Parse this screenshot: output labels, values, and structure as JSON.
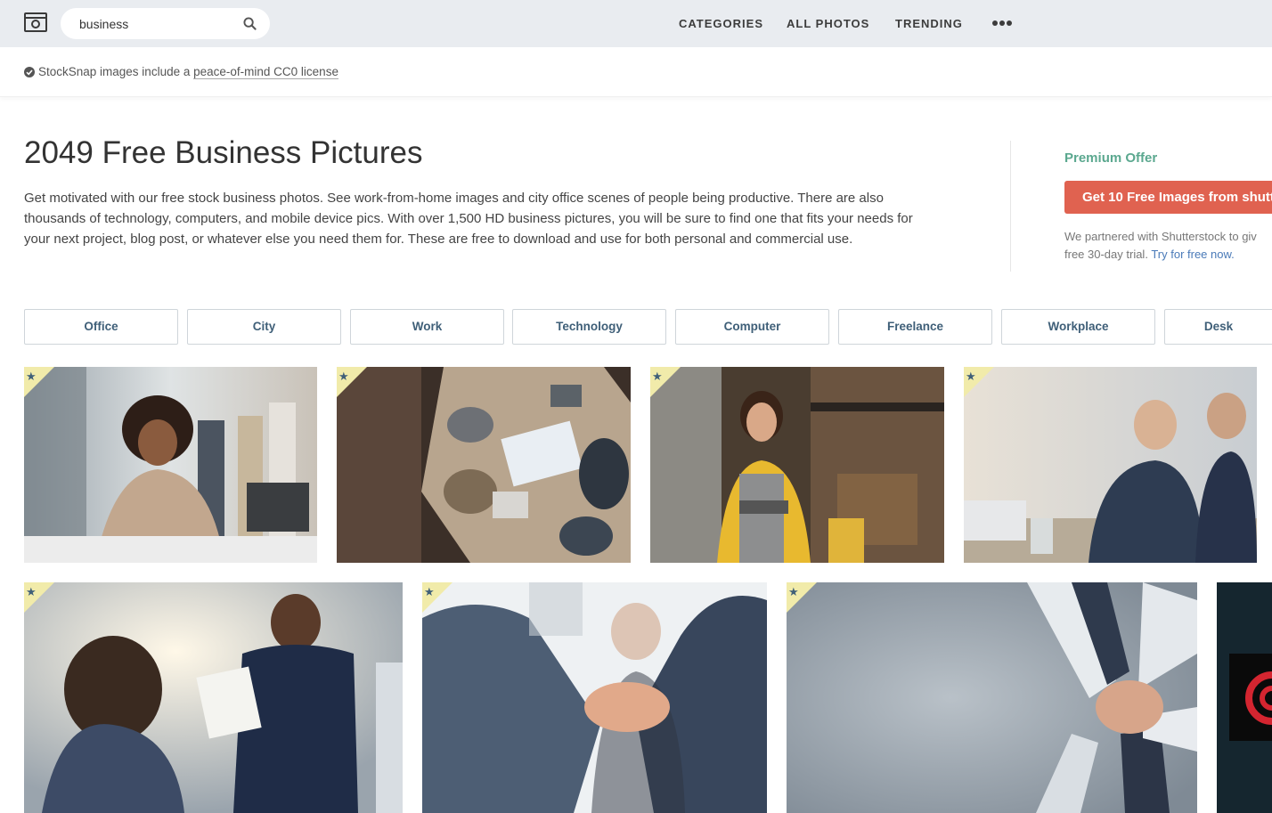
{
  "header": {
    "search_value": "business",
    "nav": [
      "CATEGORIES",
      "ALL PHOTOS",
      "TRENDING"
    ],
    "icons": {
      "logo": "camera-logo-icon",
      "search": "search-icon",
      "more": "more-dots-icon"
    }
  },
  "license": {
    "prefix": "StockSnap images include a",
    "link": "peace-of-mind CC0 license",
    "icon": "check-circle-icon"
  },
  "intro": {
    "title": "2049 Free Business Pictures",
    "description": "Get motivated with our free stock business photos. See work-from-home images and city office scenes of people being productive. There are also thousands of technology, computers, and mobile device pics. With over 1,500 HD business pictures, you will be sure to find one that fits your needs for your next project, blog post, or whatever else you need them for. These are free to download and use for both personal and commercial use."
  },
  "premium": {
    "title": "Premium Offer",
    "button": "Get 10 Free Images from shutt",
    "note_line1": "We partnered with Shutterstock to giv",
    "note_line2": "free 30-day trial.",
    "note_link": "Try for free now."
  },
  "tags": [
    "Office",
    "City",
    "Work",
    "Technology",
    "Computer",
    "Freelance",
    "Workplace",
    "Desk"
  ],
  "photos": [
    {
      "name": "woman-laptop-office",
      "premium": true
    },
    {
      "name": "team-meeting-overhead",
      "premium": true
    },
    {
      "name": "cafe-owner-tablet",
      "premium": true
    },
    {
      "name": "businessmen-discussing",
      "premium": true
    },
    {
      "name": "office-team-conversation",
      "premium": true
    },
    {
      "name": "business-handshake",
      "premium": true
    },
    {
      "name": "team-hands-stacked",
      "premium": true
    },
    {
      "name": "dark-target-graphic",
      "premium": false
    }
  ],
  "colors": {
    "topbar": "#e9ecf0",
    "accent_green": "#5ba88f",
    "cta_red": "#e06250",
    "tag_text": "#3f5f78",
    "premium_badge": "#f1ebaa"
  }
}
